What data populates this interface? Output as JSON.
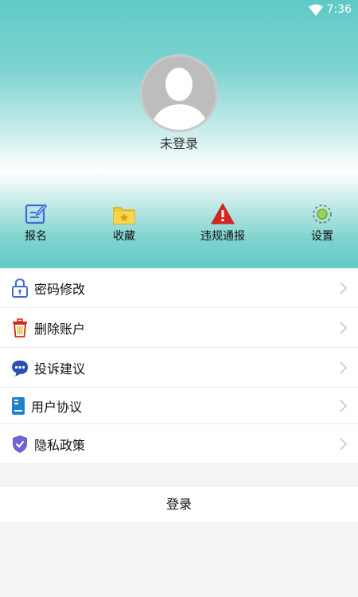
{
  "status_bar": {
    "time": "7:36",
    "wifi_icon": "wifi-icon"
  },
  "profile": {
    "avatar_icon": "default-avatar",
    "status": "未登录"
  },
  "shortcuts": [
    {
      "label": "报名",
      "icon": "edit-form-icon",
      "color": "#3f6ad8"
    },
    {
      "label": "收藏",
      "icon": "star-folder-icon",
      "color": "#e8b923"
    },
    {
      "label": "违规通报",
      "icon": "warning-icon",
      "color": "#d9261c"
    },
    {
      "label": "设置",
      "icon": "gear-icon",
      "color": "#9ad35a"
    }
  ],
  "menu": [
    {
      "label": "密码修改",
      "icon": "lock-icon"
    },
    {
      "label": "删除账户",
      "icon": "trash-icon"
    },
    {
      "label": "投诉建议",
      "icon": "chat-bubble-icon"
    },
    {
      "label": "用户协议",
      "icon": "document-icon"
    },
    {
      "label": "隐私政策",
      "icon": "shield-check-icon"
    }
  ],
  "login_button": {
    "label": "登录"
  },
  "colors": {
    "header_top": "#5ecac6",
    "header_bottom": "#63cbc6",
    "background": "#f4f4f4"
  }
}
